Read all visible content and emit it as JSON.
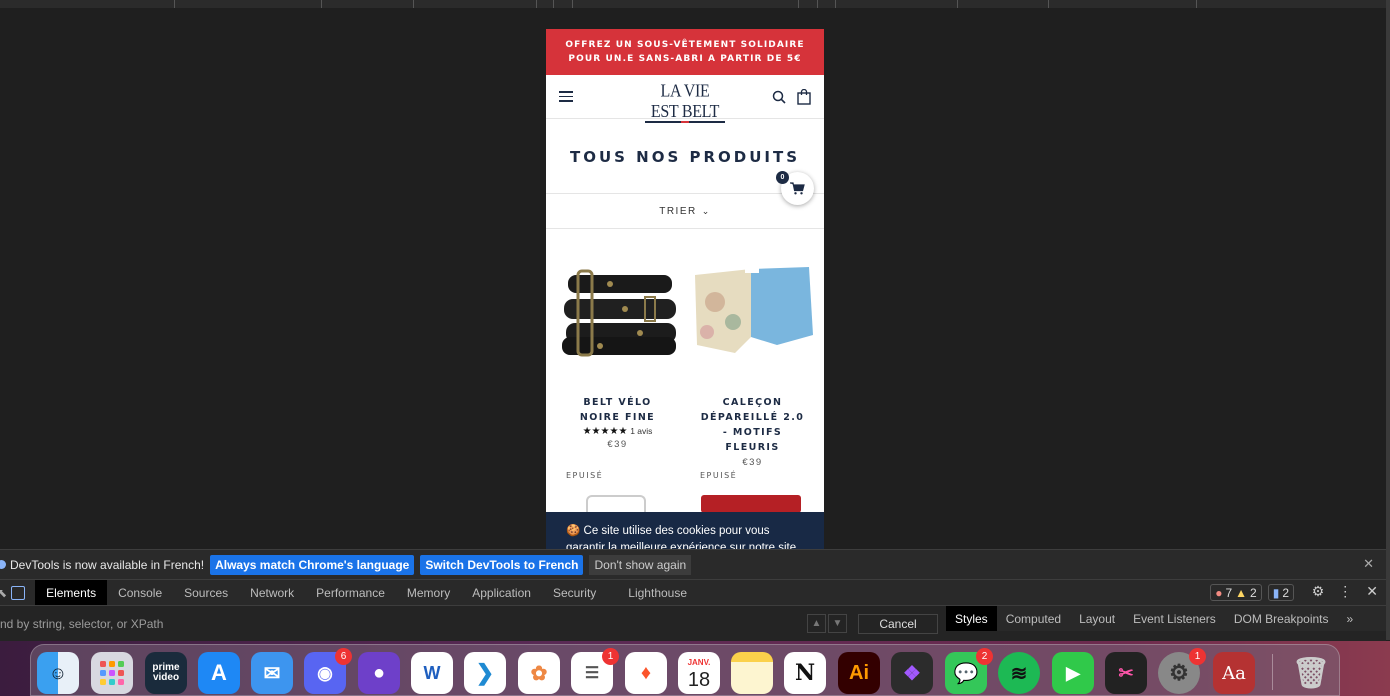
{
  "site": {
    "promo_line1": "OFFREZ UN SOUS-VÊTEMENT SOLIDAIRE",
    "promo_line2": "POUR UN.E SANS-ABRI A PARTIR DE 5€",
    "logo": "LA VIE EST BELT",
    "page_title": "TOUS NOS PRODUITS",
    "cart_count": "0",
    "sort_label": "TRIER",
    "products": [
      {
        "name": "BELT VÉLO NOIRE FINE",
        "stars": "★★★★★",
        "reviews": "1 avis",
        "price": "€39"
      },
      {
        "name": "CALEÇON DÉPAREILLÉ 2.0 - MOTIFS FLEURIS",
        "price": "€39"
      }
    ],
    "epuise_label": "EPUISÉ",
    "cookie_line1": "🍪 Ce site utilise des cookies pour vous",
    "cookie_line2": "garantir la meilleure expérience sur notre site"
  },
  "devtools": {
    "info_text": "DevTools is now available in French!",
    "btn_match": "Always match Chrome's language",
    "btn_switch": "Switch DevTools to French",
    "btn_dont": "Don't show again",
    "tabs": [
      "Elements",
      "Console",
      "Sources",
      "Network",
      "Performance",
      "Memory",
      "Application",
      "Security",
      "Lighthouse"
    ],
    "errors": "7",
    "warnings": "2",
    "messages": "2",
    "filter_placeholder": "nd by string, selector, or XPath",
    "cancel": "Cancel",
    "side_tabs": [
      "Styles",
      "Computed",
      "Layout",
      "Event Listeners",
      "DOM Breakpoints"
    ],
    "more": "»"
  },
  "dock": {
    "prime_label": "prime video",
    "calendar_month": "JANV.",
    "calendar_day": "18",
    "ai_label": "Ai",
    "dict_label": "Aa",
    "discord_badge": "6",
    "reminders_badge": "1",
    "messages_badge": "2",
    "settings_badge": "1",
    "word_label": "W"
  }
}
